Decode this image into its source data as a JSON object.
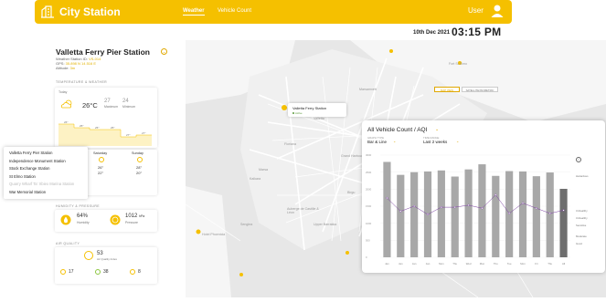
{
  "header": {
    "brand": "City Station",
    "nav": [
      "Weather",
      "Vehicle Count"
    ],
    "user_label": "User",
    "date": "10th Dec 2021",
    "time": "03:15 PM",
    "colors": {
      "accent": "#f5c000",
      "chart_bar": "#a8a8a8",
      "chart_line": "#7b3fa0"
    }
  },
  "station": {
    "name": "Valletta Ferry Pier Station",
    "meta": [
      "Weather Station ID: ",
      "GPS: ",
      "Altitude: "
    ],
    "meta_values": [
      "VS-014",
      "35.898 N 14.516 E",
      "3m"
    ]
  },
  "weather": {
    "section": "TEMPERATURE & WEATHER",
    "today": "Today",
    "temp_now": "26°C",
    "max": "27",
    "min": "24",
    "max_label": "Maximum",
    "min_label": "Minimum",
    "hour_temps": [
      "26°",
      "25°",
      "25°",
      "25°",
      "27°",
      "27°"
    ],
    "forecast": [
      {
        "day": "Saturday",
        "hi": "26°",
        "lo": "22°"
      },
      {
        "day": "Sunday",
        "hi": "28°",
        "lo": "20°"
      }
    ]
  },
  "station_dropdown": {
    "items": [
      "Valletta Ferry Pier Station",
      "Independence Monument Station",
      "Stock Exchange Station",
      "St Elmo Station",
      "Quarry Wharf Ta' Xbiex Marina Station",
      "War Memorial Station"
    ],
    "disabled_index": 4
  },
  "humidity": {
    "section": "HUMIDITY & PRESSURE",
    "humidity_value": "64%",
    "humidity_label": "Humidity",
    "pressure_value": "1012",
    "pressure_unit": "hPa",
    "pressure_label": "Pressure"
  },
  "air": {
    "section": "AIR QUALITY",
    "aqi": "53",
    "aqi_label": "Air Quality Index",
    "subs": [
      "17",
      "38",
      "8"
    ]
  },
  "map": {
    "toggles": [
      "MAP VIEW",
      "SATELLITE/ISOMETRIC"
    ],
    "popup_title": "Valletta Ferry Station",
    "popup_status": "Active",
    "labels": [
      "Fort St Elmo",
      "Marsamxett",
      "Valletta",
      "Floriana",
      "Marsa",
      "Grand Harbour",
      "Birgu",
      "Kalkara",
      "Senglea",
      "Naxxar",
      "Pietà",
      "Hotel Phoenicia",
      "Auberge de Castille & Léon",
      "Upper Barrakka",
      "St Elmo Bay"
    ]
  },
  "chart_panel": {
    "title": "All Vehicle Count / AQI",
    "graph_type_label": "GRAPH TYPE",
    "graph_type_value": "Bar & Line",
    "time_range_label": "TIME RANGE",
    "time_range_value": "Last 2 weeks",
    "legend": [
      "Hazardous",
      "Unhealthy",
      "Unhealthy",
      "Sensitive",
      "Moderate",
      "Good"
    ],
    "y_ticks": [
      "3000",
      "2500",
      "2000",
      "1500",
      "1000",
      "500",
      "0"
    ]
  },
  "chart_data": {
    "type": "bar",
    "categories": [
      "Jan",
      "Jan",
      "Jan",
      "Jan",
      "Mon",
      "Thu",
      "Wed",
      "Mon",
      "Thu",
      "Tue",
      "Mon",
      "Fri",
      "Thu",
      "All"
    ],
    "series": [
      {
        "type": "bar",
        "values": [
          2800,
          2420,
          2500,
          2520,
          2550,
          2370,
          2580,
          2730,
          2390,
          2530,
          2520,
          2380,
          2490,
          2010
        ]
      },
      {
        "type": "line",
        "values": [
          290,
          225,
          250,
          210,
          245,
          245,
          255,
          240,
          305,
          215,
          265,
          240,
          215,
          230
        ]
      }
    ],
    "ylim": [
      0,
      3000
    ],
    "aqi_ylim": [
      0,
      500
    ]
  }
}
